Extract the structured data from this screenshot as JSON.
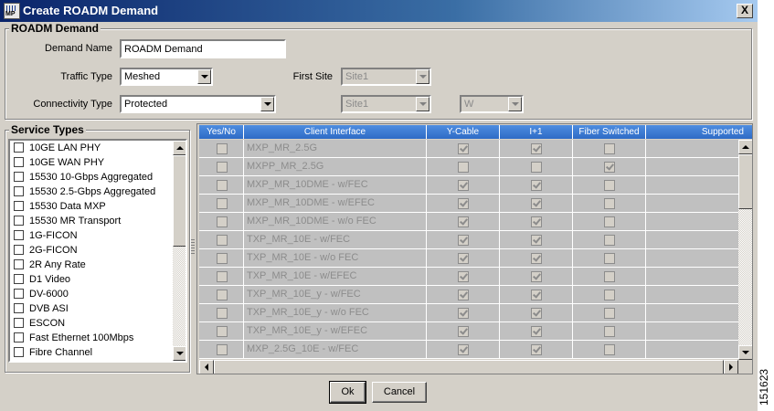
{
  "window": {
    "title": "Create ROADM Demand",
    "app_icon_text": "MP",
    "close_label": "X"
  },
  "roadm_group": {
    "title": "ROADM Demand",
    "demand_name_label": "Demand Name",
    "demand_name_value": "ROADM Demand",
    "traffic_type_label": "Traffic Type",
    "traffic_type_value": "Meshed",
    "connectivity_type_label": "Connectivity Type",
    "connectivity_type_value": "Protected",
    "first_site_label": "First Site",
    "first_site_value": "Site1",
    "second_site_value": "Site1",
    "side_value": "W"
  },
  "service_types": {
    "title": "Service Types",
    "items": [
      "10GE LAN PHY",
      "10GE WAN PHY",
      "15530 10-Gbps Aggregated",
      "15530 2.5-Gbps Aggregated",
      "15530 Data MXP",
      "15530 MR Transport",
      "1G-FICON",
      "2G-FICON",
      "2R Any Rate",
      "D1 Video",
      "DV-6000",
      "DVB ASI",
      "ESCON",
      "Fast Ethernet 100Mbps",
      "Fibre Channel"
    ]
  },
  "table": {
    "columns": [
      "Yes/No",
      "Client Interface",
      "Y-Cable",
      "I+1",
      "Fiber Switched",
      "Supported"
    ],
    "rows": [
      {
        "client": "MXP_MR_2.5G",
        "ycable": true,
        "iplus1": true,
        "fiber": false
      },
      {
        "client": "MXPP_MR_2.5G",
        "ycable": false,
        "iplus1": false,
        "fiber": true
      },
      {
        "client": "MXP_MR_10DME - w/FEC",
        "ycable": true,
        "iplus1": true,
        "fiber": false
      },
      {
        "client": "MXP_MR_10DME - w/EFEC",
        "ycable": true,
        "iplus1": true,
        "fiber": false
      },
      {
        "client": "MXP_MR_10DME - w/o FEC",
        "ycable": true,
        "iplus1": true,
        "fiber": false
      },
      {
        "client": "TXP_MR_10E - w/FEC",
        "ycable": true,
        "iplus1": true,
        "fiber": false
      },
      {
        "client": "TXP_MR_10E - w/o FEC",
        "ycable": true,
        "iplus1": true,
        "fiber": false
      },
      {
        "client": "TXP_MR_10E - w/EFEC",
        "ycable": true,
        "iplus1": true,
        "fiber": false
      },
      {
        "client": "TXP_MR_10E_y - w/FEC",
        "ycable": true,
        "iplus1": true,
        "fiber": false
      },
      {
        "client": "TXP_MR_10E_y - w/o FEC",
        "ycable": true,
        "iplus1": true,
        "fiber": false
      },
      {
        "client": "TXP_MR_10E_y - w/EFEC",
        "ycable": true,
        "iplus1": true,
        "fiber": false
      },
      {
        "client": "MXP_2.5G_10E - w/FEC",
        "ycable": true,
        "iplus1": true,
        "fiber": false
      }
    ]
  },
  "buttons": {
    "ok": "Ok",
    "cancel": "Cancel"
  },
  "figure_id": "151623"
}
